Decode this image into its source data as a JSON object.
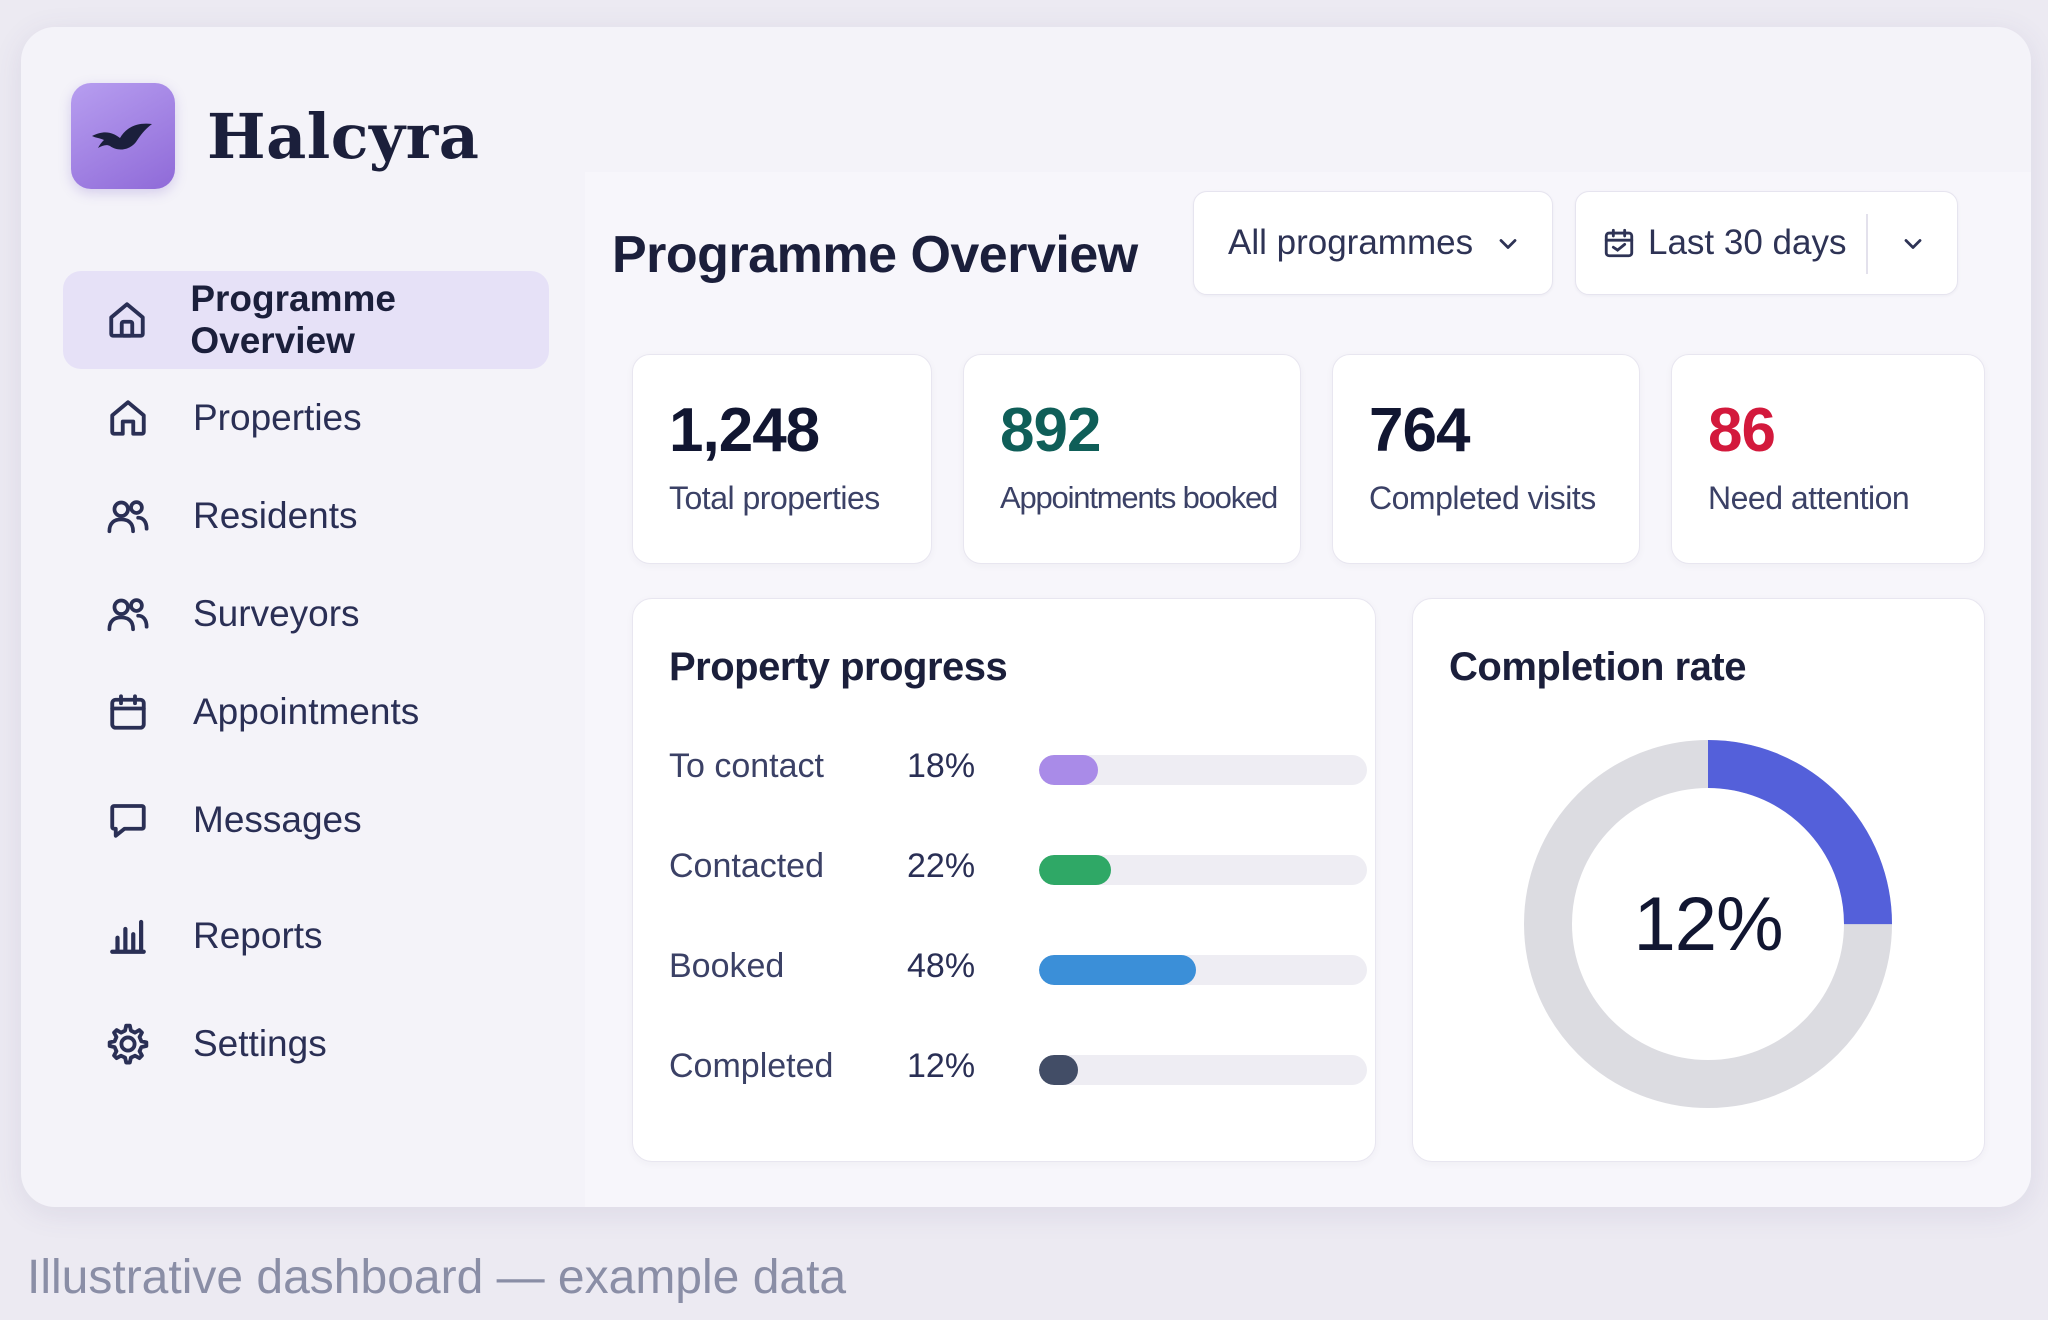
{
  "app": {
    "name": "Halcyra",
    "logo_icon": "bird-icon",
    "brand_color": "#9b7be0"
  },
  "sidebar": {
    "items": [
      {
        "label": "Programme Overview",
        "icon": "home-icon",
        "active": true
      },
      {
        "label": "Properties",
        "icon": "home-icon",
        "active": false
      },
      {
        "label": "Residents",
        "icon": "users-icon",
        "active": false
      },
      {
        "label": "Surveyors",
        "icon": "users-icon",
        "active": false
      },
      {
        "label": "Appointments",
        "icon": "calendar-icon",
        "active": false
      },
      {
        "label": "Messages",
        "icon": "chat-icon",
        "active": false
      },
      {
        "label": "Reports",
        "icon": "bar-chart-icon",
        "active": false
      },
      {
        "label": "Settings",
        "icon": "gear-icon",
        "active": false
      }
    ]
  },
  "header": {
    "title": "Programme Overview",
    "programme_filter": {
      "value": "All programmes",
      "icon": "chevron-down-icon"
    },
    "date_filter": {
      "value": "Last 30 days",
      "icon": "calendar-icon"
    }
  },
  "stats": [
    {
      "value": "1,248",
      "label": "Total properties",
      "color": "#111631"
    },
    {
      "value": "892",
      "label": "Appointments booked",
      "color": "#0f5e58"
    },
    {
      "value": "764",
      "label": "Completed visits",
      "color": "#111631"
    },
    {
      "value": "86",
      "label": "Need attention",
      "color": "#d3193c"
    }
  ],
  "progress": {
    "title": "Property progress",
    "rows": [
      {
        "label": "To contact",
        "pct_text": "18%",
        "fraction": 0.18,
        "color": "#a98be8"
      },
      {
        "label": "Contacted",
        "pct_text": "22%",
        "fraction": 0.22,
        "color": "#2fa866"
      },
      {
        "label": "Booked",
        "pct_text": "48%",
        "fraction": 0.48,
        "color": "#3b8fd8"
      },
      {
        "label": "Completed",
        "pct_text": "12%",
        "fraction": 0.12,
        "color": "#424d66"
      }
    ]
  },
  "completion": {
    "title": "Completion rate",
    "value_text": "12%",
    "fraction": 0.25,
    "accent_color": "#5460da",
    "track_color": "#dcdce1"
  },
  "caption": "Illustrative dashboard — example data"
}
